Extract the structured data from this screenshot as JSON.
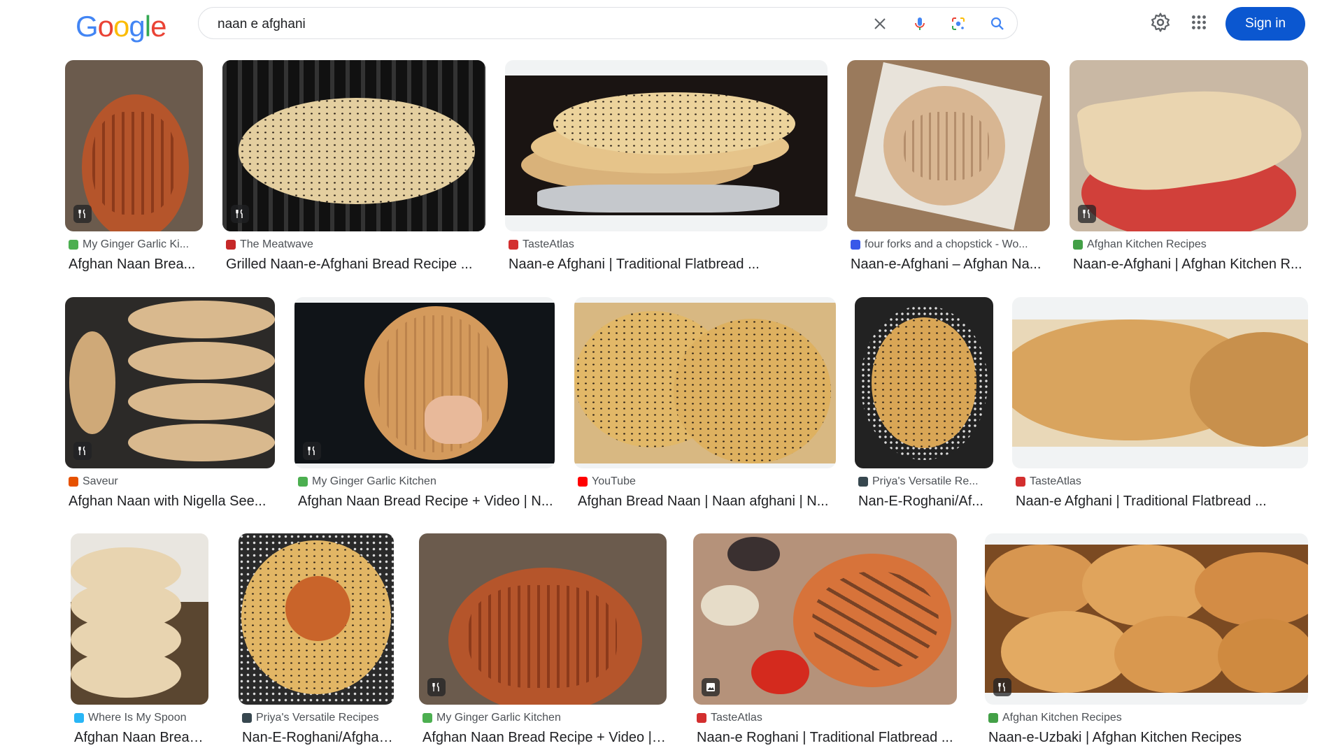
{
  "header": {
    "logo_text": "Google",
    "logo_colors": [
      "#4285f4",
      "#ea4335",
      "#fbbc05",
      "#4285f4",
      "#34a853",
      "#ea4335"
    ],
    "search": {
      "value": "naan e afghani"
    },
    "signin_label": "Sign in",
    "icons": [
      "close-icon",
      "microphone-icon",
      "lens-icon",
      "search-icon",
      "gear-icon",
      "apps-icon"
    ]
  },
  "accent_color": "#0b57d0",
  "results": [
    {
      "source": "My Ginger Garlic Ki...",
      "title": "Afghan Naan Brea...",
      "favicon": "ginger-icon",
      "badge": "recipe-icon"
    },
    {
      "source": "The Meatwave",
      "title": "Grilled Naan-e-Afghani Bread Recipe ...",
      "favicon": "meatwave-icon",
      "badge": "recipe-icon"
    },
    {
      "source": "TasteAtlas",
      "title": "Naan-e Afghani | Traditional Flatbread ...",
      "favicon": "tasteatlas-icon",
      "badge": ""
    },
    {
      "source": "four forks and a chopstick - Wo...",
      "title": "Naan-e-Afghani – Afghan Na...",
      "favicon": "wordpress-icon",
      "badge": ""
    },
    {
      "source": "Afghan Kitchen Recipes",
      "title": "Naan-e-Afghani | Afghan Kitchen R...",
      "favicon": "afghankitchen-icon",
      "badge": "recipe-icon"
    },
    {
      "source": "Saveur",
      "title": "Afghan Naan with Nigella See...",
      "favicon": "saveur-icon",
      "badge": "recipe-icon"
    },
    {
      "source": "My Ginger Garlic Kitchen",
      "title": "Afghan Naan Bread Recipe + Video | N...",
      "favicon": "ginger-icon",
      "badge": "recipe-icon"
    },
    {
      "source": "YouTube",
      "title": "Afghan Bread Naan | Naan afghani | N...",
      "favicon": "youtube-icon",
      "badge": ""
    },
    {
      "source": "Priya's Versatile Re...",
      "title": "Nan-E-Roghani/Af...",
      "favicon": "priya-icon",
      "badge": ""
    },
    {
      "source": "TasteAtlas",
      "title": "Naan-e Afghani | Traditional Flatbread ...",
      "favicon": "tasteatlas-icon",
      "badge": ""
    },
    {
      "source": "Where Is My Spoon",
      "title": "Afghan Naan Bread (...",
      "favicon": "spoon-icon",
      "badge": ""
    },
    {
      "source": "Priya's Versatile Recipes",
      "title": "Nan-E-Roghani/Afghan...",
      "favicon": "priya-icon",
      "badge": ""
    },
    {
      "source": "My Ginger Garlic Kitchen",
      "title": "Afghan Naan Bread Recipe + Video | ...",
      "favicon": "ginger-icon",
      "badge": "recipe-icon"
    },
    {
      "source": "TasteAtlas",
      "title": "Naan-e Roghani | Traditional Flatbread ...",
      "favicon": "tasteatlas-icon",
      "badge": "image-icon"
    },
    {
      "source": "Afghan Kitchen Recipes",
      "title": "Naan-e-Uzbaki | Afghan Kitchen Recipes",
      "favicon": "afghankitchen-icon",
      "badge": "recipe-icon"
    }
  ]
}
